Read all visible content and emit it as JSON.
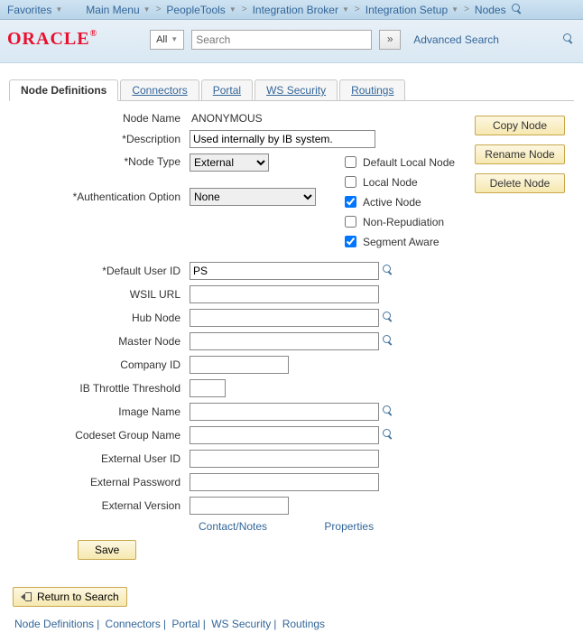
{
  "topnav": {
    "favorites": "Favorites",
    "mainmenu": "Main Menu",
    "crumbs": [
      "PeopleTools",
      "Integration Broker",
      "Integration Setup",
      "Nodes"
    ]
  },
  "search": {
    "scope": "All",
    "placeholder": "Search",
    "advanced": "Advanced Search"
  },
  "tabs": [
    "Node Definitions",
    "Connectors",
    "Portal",
    "WS Security",
    "Routings"
  ],
  "actions": {
    "copy": "Copy Node",
    "rename": "Rename Node",
    "delete": "Delete Node"
  },
  "form": {
    "node_name_lbl": "Node Name",
    "node_name": "ANONYMOUS",
    "desc_lbl": "*Description",
    "desc": "Used internally by IB system.",
    "node_type_lbl": "*Node Type",
    "node_type": "External",
    "auth_lbl": "*Authentication Option",
    "auth": "None",
    "checks": {
      "default_local": {
        "label": "Default Local Node",
        "checked": false
      },
      "local_node": {
        "label": "Local Node",
        "checked": false
      },
      "active_node": {
        "label": "Active Node",
        "checked": true
      },
      "non_repudiation": {
        "label": "Non-Repudiation",
        "checked": false
      },
      "segment_aware": {
        "label": "Segment Aware",
        "checked": true
      }
    },
    "default_user_lbl": "*Default User ID",
    "default_user": "PS",
    "wsil_lbl": "WSIL URL",
    "wsil": "",
    "hub_lbl": "Hub Node",
    "hub": "",
    "master_lbl": "Master Node",
    "master": "",
    "company_lbl": "Company ID",
    "company": "",
    "throttle_lbl": "IB Throttle Threshold",
    "throttle": "",
    "image_lbl": "Image Name",
    "image": "",
    "codeset_lbl": "Codeset Group Name",
    "codeset": "",
    "ext_user_lbl": "External User ID",
    "ext_user": "",
    "ext_pass_lbl": "External Password",
    "ext_pass": "",
    "ext_ver_lbl": "External Version",
    "ext_ver": ""
  },
  "links": {
    "contact": "Contact/Notes",
    "properties": "Properties"
  },
  "buttons": {
    "save": "Save",
    "return": "Return to Search"
  },
  "footer": [
    "Node Definitions",
    "Connectors",
    "Portal",
    "WS Security",
    "Routings"
  ]
}
